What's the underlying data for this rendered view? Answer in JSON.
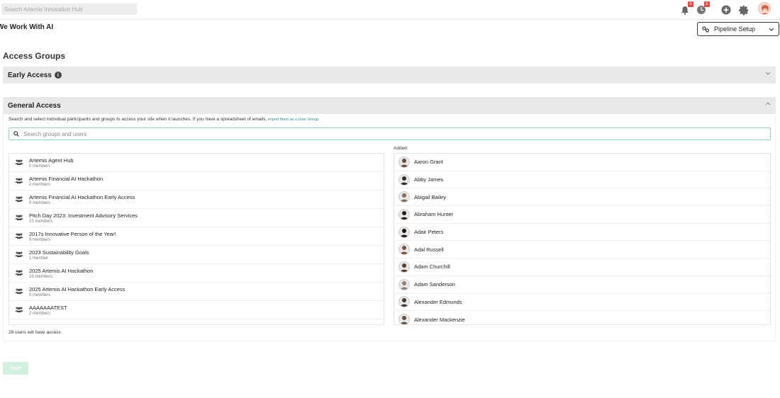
{
  "topbar": {
    "search_placeholder": "Search Artemis Innovation Hub",
    "notifications_count": "5",
    "activity_count": "5"
  },
  "page": {
    "title": "We Work With AI",
    "pipeline_setup_label": "Pipeline Setup"
  },
  "access_groups": {
    "title": "Access Groups",
    "early_access_label": "Early Access",
    "general_access_label": "General Access",
    "description": "Search and select individual participants and groups to access your site when it launches. If you have a spreadsheet of emails,",
    "import_link": "import them as a User Group.",
    "search_placeholder": "Search groups and users",
    "added_label": "Added:",
    "users_count_text": "28 users will have access",
    "save_label": "Save"
  },
  "groups": [
    {
      "name": "Artemis Agent Hub",
      "members": "0 members"
    },
    {
      "name": "Artemis Financial AI Hackathon",
      "members": "2 members"
    },
    {
      "name": "Artemis Financial AI Hackathon Early Access",
      "members": "0 members"
    },
    {
      "name": "Pitch Day 2023: Investment Advisory Services",
      "members": "13 members"
    },
    {
      "name": "2017s Innovative Person of the Year!",
      "members": "9 members"
    },
    {
      "name": "2023 Sustainability Goals",
      "members": "1 member"
    },
    {
      "name": "2025 Artemis AI Hackathon",
      "members": "16 members"
    },
    {
      "name": "2025 Artemis AI Hackathon Early Access",
      "members": "0 members"
    },
    {
      "name": "AAAAAAATEST",
      "members": "2 members"
    }
  ],
  "users": [
    {
      "name": "Aaron Grant",
      "color": "#6b4a3a"
    },
    {
      "name": "Abby James",
      "color": "#3a2a22"
    },
    {
      "name": "Abigail Bailey",
      "color": "#8a6a55"
    },
    {
      "name": "Abraham Hunter",
      "color": "#2a1e18"
    },
    {
      "name": "Adair Peters",
      "color": "#1e1410"
    },
    {
      "name": "Adal Russell",
      "color": "#7a5040"
    },
    {
      "name": "Adam Churchill",
      "color": "#5a3e30"
    },
    {
      "name": "Adam Sanderson",
      "color": "#9a8070"
    },
    {
      "name": "Alexander Edmunds",
      "color": "#4a3428"
    },
    {
      "name": "Alexander Mackenzie",
      "color": "#6a5040"
    }
  ],
  "colors": {
    "accent": "#2a8a8e",
    "badge": "#e2473f",
    "save_disabled": "#d3f0df",
    "header_bg": "#e9e9e9"
  }
}
